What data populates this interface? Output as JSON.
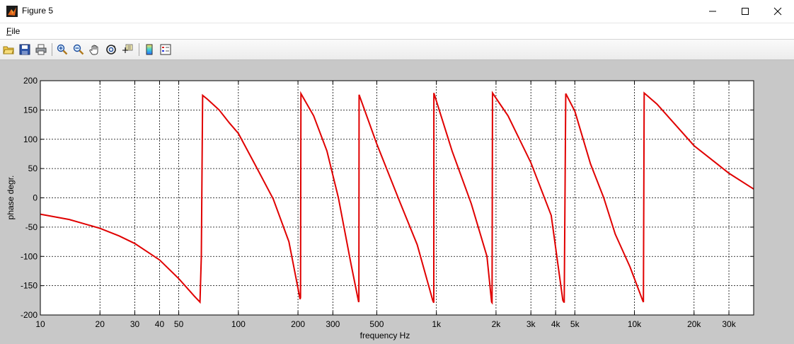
{
  "window": {
    "title": "Figure 5",
    "minimize_icon": "minimize-icon",
    "maximize_icon": "maximize-icon",
    "close_icon": "close-icon"
  },
  "menu": {
    "file_label": "File",
    "file_mnemonic": "F",
    "file_rest": "ile"
  },
  "toolbar": {
    "buttons": [
      "open-icon",
      "save-icon",
      "print-icon",
      "zoom-in-icon",
      "zoom-out-icon",
      "pan-icon",
      "rotate-3d-icon",
      "data-cursor-icon",
      "colorbar-icon",
      "legend-icon"
    ]
  },
  "chart_data": {
    "type": "line",
    "xscale": "log",
    "xlim": [
      10,
      40000
    ],
    "ylim": [
      -200,
      200
    ],
    "grid": true,
    "xlabel": "frequency   Hz",
    "ylabel": "phase degr.",
    "color": "#e00000",
    "yticks": [
      200,
      150,
      100,
      50,
      0,
      -50,
      -100,
      -150,
      -200
    ],
    "xticks": [
      {
        "value": 10,
        "label": "10"
      },
      {
        "value": 20,
        "label": "20"
      },
      {
        "value": 30,
        "label": "30"
      },
      {
        "value": 40,
        "label": "40"
      },
      {
        "value": 50,
        "label": "50"
      },
      {
        "value": 100,
        "label": "100"
      },
      {
        "value": 200,
        "label": "200"
      },
      {
        "value": 300,
        "label": "300"
      },
      {
        "value": 500,
        "label": "500"
      },
      {
        "value": 1000,
        "label": "1k"
      },
      {
        "value": 2000,
        "label": "2k"
      },
      {
        "value": 3000,
        "label": "3k"
      },
      {
        "value": 4000,
        "label": "4k"
      },
      {
        "value": 5000,
        "label": "5k"
      },
      {
        "value": 10000,
        "label": "10k"
      },
      {
        "value": 20000,
        "label": "20k"
      },
      {
        "value": 30000,
        "label": "30k"
      }
    ],
    "series": [
      {
        "x": [
          10,
          14,
          20,
          25,
          30,
          40,
          50,
          60,
          64,
          65,
          66,
          70,
          80,
          90,
          100,
          120,
          150,
          180,
          205,
          206,
          207,
          240,
          280,
          320,
          370,
          405,
          406,
          407,
          500,
          650,
          800,
          960,
          970,
          971,
          1200,
          1500,
          1800,
          1900,
          1910,
          1920,
          2300,
          3000,
          3800,
          4350,
          4400,
          4420,
          4500,
          5000,
          6000,
          7000,
          8000,
          9500,
          11000,
          11100,
          11200,
          13000,
          20000,
          30000,
          40000
        ],
        "y": [
          -28,
          -37,
          -52,
          -65,
          -78,
          -106,
          -138,
          -168,
          -178,
          -100,
          175,
          168,
          150,
          128,
          110,
          60,
          -2,
          -75,
          -173,
          -170,
          178,
          140,
          80,
          0,
          -112,
          -178,
          -176,
          176,
          92,
          -5,
          -80,
          -176,
          -179,
          179,
          80,
          -10,
          -100,
          -178,
          -179,
          179,
          140,
          60,
          -30,
          -175,
          -178,
          -178,
          178,
          148,
          58,
          0,
          -62,
          -118,
          -175,
          -178,
          179,
          160,
          89,
          42,
          15
        ]
      }
    ]
  }
}
